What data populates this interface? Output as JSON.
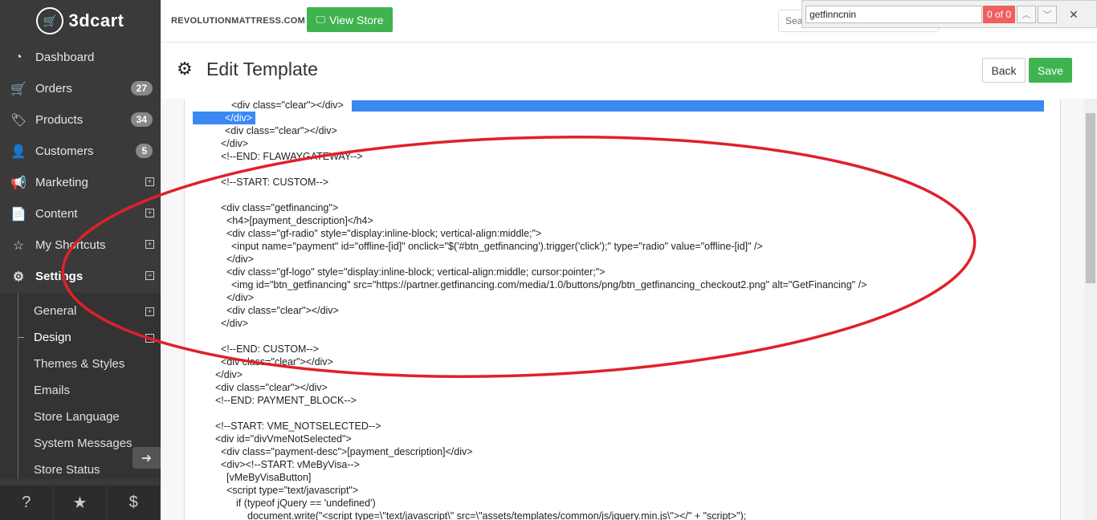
{
  "sidebar": {
    "logo": "3dcart",
    "items": [
      {
        "label": "Dashboard",
        "icon": "dashboard-icon",
        "glyph": "◔"
      },
      {
        "label": "Orders",
        "icon": "cart-icon",
        "glyph": "🛒",
        "badge": "27"
      },
      {
        "label": "Products",
        "icon": "tags-icon",
        "glyph": "🏷",
        "badge": "34"
      },
      {
        "label": "Customers",
        "icon": "user-icon",
        "glyph": "👤",
        "badge": "5"
      },
      {
        "label": "Marketing",
        "icon": "megaphone-icon",
        "glyph": "📢",
        "expand": "⊞"
      },
      {
        "label": "Content",
        "icon": "document-icon",
        "glyph": "📄",
        "expand": "⊞"
      },
      {
        "label": "My Shortcuts",
        "icon": "star-outline-icon",
        "glyph": "☆",
        "expand": "⊞"
      },
      {
        "label": "Settings",
        "icon": "gears-icon",
        "glyph": "⚙",
        "expand": "⊟"
      }
    ],
    "submenu": [
      {
        "label": "General",
        "expand": "⊞"
      },
      {
        "label": "Design",
        "expand": "⊟"
      },
      {
        "label": "Themes & Styles"
      },
      {
        "label": "Emails"
      },
      {
        "label": "Store Language"
      },
      {
        "label": "System Messages"
      },
      {
        "label": "Store Status"
      }
    ],
    "footer": [
      "?",
      "★",
      "$"
    ]
  },
  "topbar": {
    "store_name": "REVOLUTIONMATTRESS.COM",
    "view_store_label": "View Store",
    "search_placeholder": "Search by Keyword"
  },
  "findbar": {
    "query": "getfinncnin",
    "count": "0 of 0"
  },
  "header": {
    "title": "Edit Template",
    "back_label": "Back",
    "save_label": "Save"
  },
  "editor": {
    "lines": [
      {
        "indent": 58,
        "text": "<div class=\"clear\"></div>"
      },
      {
        "indent": 50,
        "text": "</div>"
      },
      {
        "indent": 50,
        "text": "<div class=\"clear\"></div>"
      },
      {
        "indent": 45,
        "text": "</div>"
      },
      {
        "indent": 45,
        "text": "<!--END: FLAWAYGATEWAY-->"
      },
      {
        "indent": 45,
        "text": ""
      },
      {
        "indent": 45,
        "text": "<!--START: CUSTOM-->"
      },
      {
        "indent": 45,
        "text": ""
      },
      {
        "indent": 45,
        "text": "<div class=\"getfinancing\">"
      },
      {
        "indent": 52,
        "text": "<h4>[payment_description]</h4>"
      },
      {
        "indent": 52,
        "text": "<div class=\"gf-radio\" style=\"display:inline-block; vertical-align:middle;\">"
      },
      {
        "indent": 58,
        "text": "<input name=\"payment\" id=\"offline-[id]\" onclick=\"$('#btn_getfinancing').trigger('click');\" type=\"radio\" value=\"offline-[id]\" />"
      },
      {
        "indent": 52,
        "text": "</div>"
      },
      {
        "indent": 52,
        "text": "<div class=\"gf-logo\" style=\"display:inline-block; vertical-align:middle; cursor:pointer;\">"
      },
      {
        "indent": 58,
        "text": "<img id=\"btn_getfinancing\" src=\"https://partner.getfinancing.com/media/1.0/buttons/png/btn_getfinancing_checkout2.png\" alt=\"GetFinancing\" />"
      },
      {
        "indent": 52,
        "text": "</div>"
      },
      {
        "indent": 52,
        "text": "<div class=\"clear\"></div>"
      },
      {
        "indent": 45,
        "text": "</div>"
      },
      {
        "indent": 45,
        "text": ""
      },
      {
        "indent": 45,
        "text": "<!--END: CUSTOM-->"
      },
      {
        "indent": 45,
        "text": "<div class=\"clear\"></div>"
      },
      {
        "indent": 38,
        "text": "</div>"
      },
      {
        "indent": 38,
        "text": "<div class=\"clear\"></div>"
      },
      {
        "indent": 38,
        "text": "<!--END: PAYMENT_BLOCK-->"
      },
      {
        "indent": 38,
        "text": ""
      },
      {
        "indent": 38,
        "text": "<!--START: VME_NOTSELECTED-->"
      },
      {
        "indent": 38,
        "text": "<div id=\"divVmeNotSelected\">"
      },
      {
        "indent": 45,
        "text": "<div class=\"payment-desc\">[payment_description]</div>"
      },
      {
        "indent": 45,
        "text": "<div><!--START: vMeByVisa-->"
      },
      {
        "indent": 52,
        "text": "[vMeByVisaButton]"
      },
      {
        "indent": 52,
        "text": "<script type=\"text/javascript\">"
      },
      {
        "indent": 64,
        "text": "if (typeof jQuery == 'undefined')"
      },
      {
        "indent": 78,
        "text": "document.write(\"<script type=\\\"text/javascript\\\" src=\\\"assets/templates/common/js/jquery.min.js\\\"></\" + \"script>\");"
      }
    ]
  },
  "colors": {
    "sidebar_bg": "#3a3a3a",
    "accent_green": "#3fb34f",
    "selection_blue": "#3b88f5",
    "annotation_red": "#e0202a",
    "find_no_match": "#f06060"
  }
}
